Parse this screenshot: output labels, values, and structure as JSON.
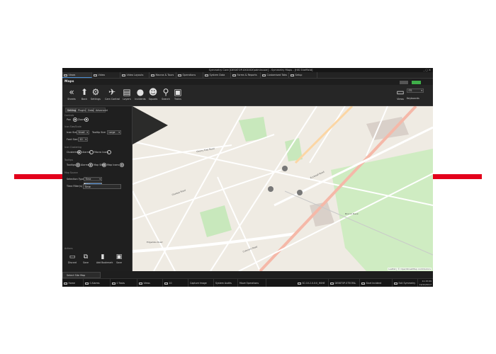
{
  "window": {
    "title": "Symmetry Core [DESKTOP-XXXXXX\\adminuser] - Symmetry Maps - [HIS Sheffield]",
    "controls": "_ ▢ ✕"
  },
  "main_tabs": [
    {
      "label": "Views",
      "active": true
    },
    {
      "label": "Video",
      "active": false
    },
    {
      "label": "Video Layouts",
      "active": false
    },
    {
      "label": "Macros & Tours",
      "active": false
    },
    {
      "label": "Operations",
      "active": false
    },
    {
      "label": "System Data",
      "active": false
    },
    {
      "label": "Forms & Reports",
      "active": false
    },
    {
      "label": "Customised Tabs",
      "active": false
    },
    {
      "label": "Setup",
      "active": false
    }
  ],
  "section_title": "Maps",
  "ribbon": [
    {
      "label": "Sheets",
      "icon": "chevrons-left-icon"
    },
    {
      "label": "Back",
      "icon": "up-arrow-icon"
    },
    {
      "label": "Settings",
      "icon": "settings-icon"
    },
    {
      "label": "Cam Control",
      "icon": "camera-control-icon"
    },
    {
      "label": "Layers",
      "icon": "layers-icon"
    },
    {
      "label": "Incidents",
      "icon": "incidents-icon"
    },
    {
      "label": "Squads",
      "icon": "squads-icon"
    },
    {
      "label": "Search",
      "icon": "search-icon"
    },
    {
      "label": "Trains",
      "icon": "train-icon"
    }
  ],
  "ribbon_right": [
    {
      "label": "Views",
      "value": "ITS"
    },
    {
      "label": "Keyboards",
      "value": ""
    }
  ],
  "side_tabs": [
    {
      "label": "Settings",
      "active": true
    },
    {
      "label": "Plugins",
      "active": false
    },
    {
      "label": "Data",
      "active": false
    },
    {
      "label": "Advanced",
      "active": false
    }
  ],
  "settings": {
    "controls_group": "Controls",
    "pan_label": "Pan",
    "pan_option": "Zoom",
    "icon_size_group": "Icon Size/Scale",
    "icon_size_label": "Icon Size",
    "icon_size_value": "Small",
    "tooltip_size_label": "Tooltip Size",
    "tooltip_size_value": "Large",
    "font_size_label": "Font Size",
    "font_size_value": "10",
    "icon_clustering_group": "Icon Clustering",
    "clustering_label": "Clustering",
    "clustering_options": [
      "Alarms",
      "Macro Icons"
    ],
    "tooltips_group": "Tooltips",
    "tooltips_label": "Tooltips",
    "tooltips_options": [
      "Alarms",
      "Map Sites",
      "Map Icons"
    ],
    "map_source_group": "Map Source",
    "selection_type_label": "Selection Type",
    "selection_type_value": "Time",
    "dropdown_options": [
      "Time"
    ],
    "time_filter_label": "Time Filter(s)",
    "time_filter_value": "Time"
  },
  "actions": {
    "group": "Actions",
    "buttons": [
      {
        "label": "Discard",
        "icon": "discard-icon"
      },
      {
        "label": "Save",
        "icon": "save-as-icon"
      },
      {
        "label": "Add Bookmark",
        "icon": "bookmark-icon"
      },
      {
        "label": "Save",
        "icon": "save-icon"
      }
    ]
  },
  "map": {
    "labels": [
      "Edgedale Road",
      "Ecclesall Road",
      "Chelsea Road",
      "Cherry Tree Road",
      "Brocco Bank",
      "Crescent Road"
    ],
    "attribution": "Leaflet | © OpenStreetMap contributors"
  },
  "bottom_tab": "Select Site Map",
  "statusbar": [
    {
      "label": "Home",
      "icon": "home-icon"
    },
    {
      "label": "0 Alarms",
      "icon": "bell-icon"
    },
    {
      "label": "0 Tasks",
      "icon": "tasks-icon"
    },
    {
      "label": "Views",
      "icon": "monitor-icon"
    },
    {
      "label": "10",
      "icon": "star-icon"
    },
    {
      "label": "Capture Image",
      "icon": ""
    },
    {
      "label": "System Audits",
      "icon": ""
    },
    {
      "label": "Move Operations",
      "icon": ""
    },
    {
      "label": "SC:10.2.0.0:0_H0HE",
      "icon": "monitor-icon"
    },
    {
      "label": "DESKTOP-ST5OFAL",
      "icon": "monitor-icon"
    },
    {
      "label": "Start Incident",
      "icon": "info-icon"
    },
    {
      "label": "Exit Symmetry",
      "icon": "close-icon"
    }
  ],
  "clock": {
    "time": "11:15:09",
    "date": "19/10/2017"
  },
  "colors": {
    "accent_red": "#e3001b",
    "toggle_green": "#3fae49",
    "app_bg": "#1e1e1e"
  }
}
